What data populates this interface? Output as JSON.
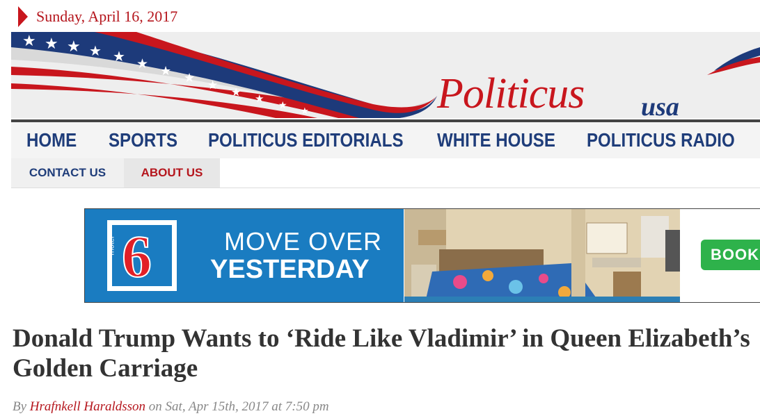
{
  "date": "Sunday, April 16, 2017",
  "logo": {
    "script": "Politicus",
    "suffix": "usa"
  },
  "nav_primary": [
    "HOME",
    "SPORTS",
    "POLITICUS EDITORIALS",
    "WHITE HOUSE",
    "POLITICUS RADIO"
  ],
  "nav_secondary": [
    "CONTACT US",
    "ABOUT US"
  ],
  "ad": {
    "brand_motel": "motel",
    "brand_number": "6",
    "line1": "MOVE OVER",
    "line2": "YESTERDAY",
    "button": "BOOK"
  },
  "article": {
    "title": "Donald Trump Wants to ‘Ride Like Vladimir’ in Queen Elizabeth’s Golden Carriage",
    "by": "By",
    "author": "Hrafnkell Haraldsson",
    "date_text": "on Sat, Apr 15th, 2017 at 7:50 pm"
  },
  "colors": {
    "accent_red": "#b5161d",
    "nav_blue": "#1f3d7a",
    "ad_blue": "#1a7cc1",
    "book_green": "#2eb24b"
  }
}
